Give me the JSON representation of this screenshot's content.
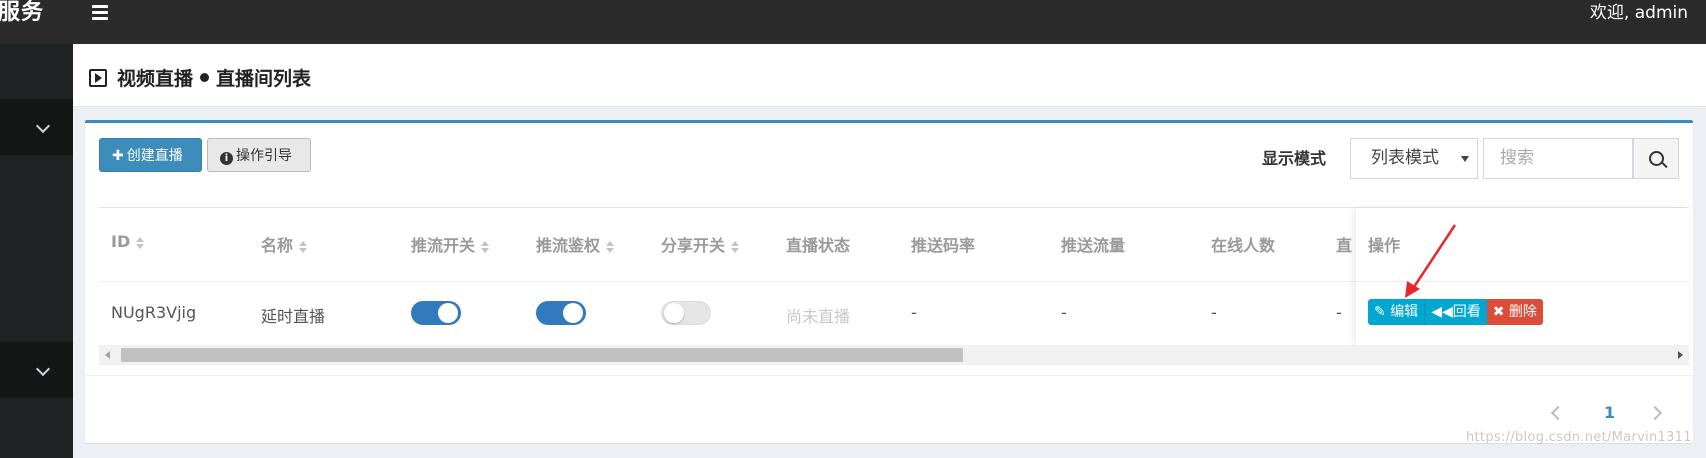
{
  "header": {
    "brand": "服务",
    "welcome": "欢迎, admin"
  },
  "breadcrumb": {
    "section": "视频直播",
    "page": "直播间列表"
  },
  "toolbar": {
    "create_label": "创建直播",
    "guide_label": "操作引导",
    "display_mode_label": "显示模式",
    "display_mode_value": "列表模式",
    "search_placeholder": "搜索"
  },
  "table": {
    "columns": [
      "ID",
      "名称",
      "推流开关",
      "推流鉴权",
      "分享开关",
      "直播状态",
      "推送码率",
      "推送流量",
      "在线人数",
      "直",
      "操作"
    ],
    "rows": [
      {
        "id": "NUgR3Vjig",
        "name": "延时直播",
        "push_switch": true,
        "push_auth": true,
        "share_switch": false,
        "status": "尚未直播",
        "bitrate": "-",
        "traffic": "-",
        "online": "-",
        "cut": "-"
      }
    ],
    "actions": {
      "edit": "编辑",
      "replay": "回看",
      "delete": "删除"
    }
  },
  "pagination": {
    "current": "1"
  },
  "watermark": "https://blog.csdn.net/Marvin1311",
  "colors": {
    "primary": "#3c8dbc",
    "info": "#00a7d0",
    "danger": "#dd4b39",
    "annotation": "#e8262b"
  },
  "icons": [
    "menu-icon",
    "chevron-down-icon",
    "play-square-icon",
    "plus-icon",
    "info-circle-icon",
    "caret-down-icon",
    "search-icon",
    "sort-icon",
    "edit-icon",
    "backward-icon",
    "times-icon",
    "chevron-left-icon",
    "chevron-right-icon"
  ]
}
